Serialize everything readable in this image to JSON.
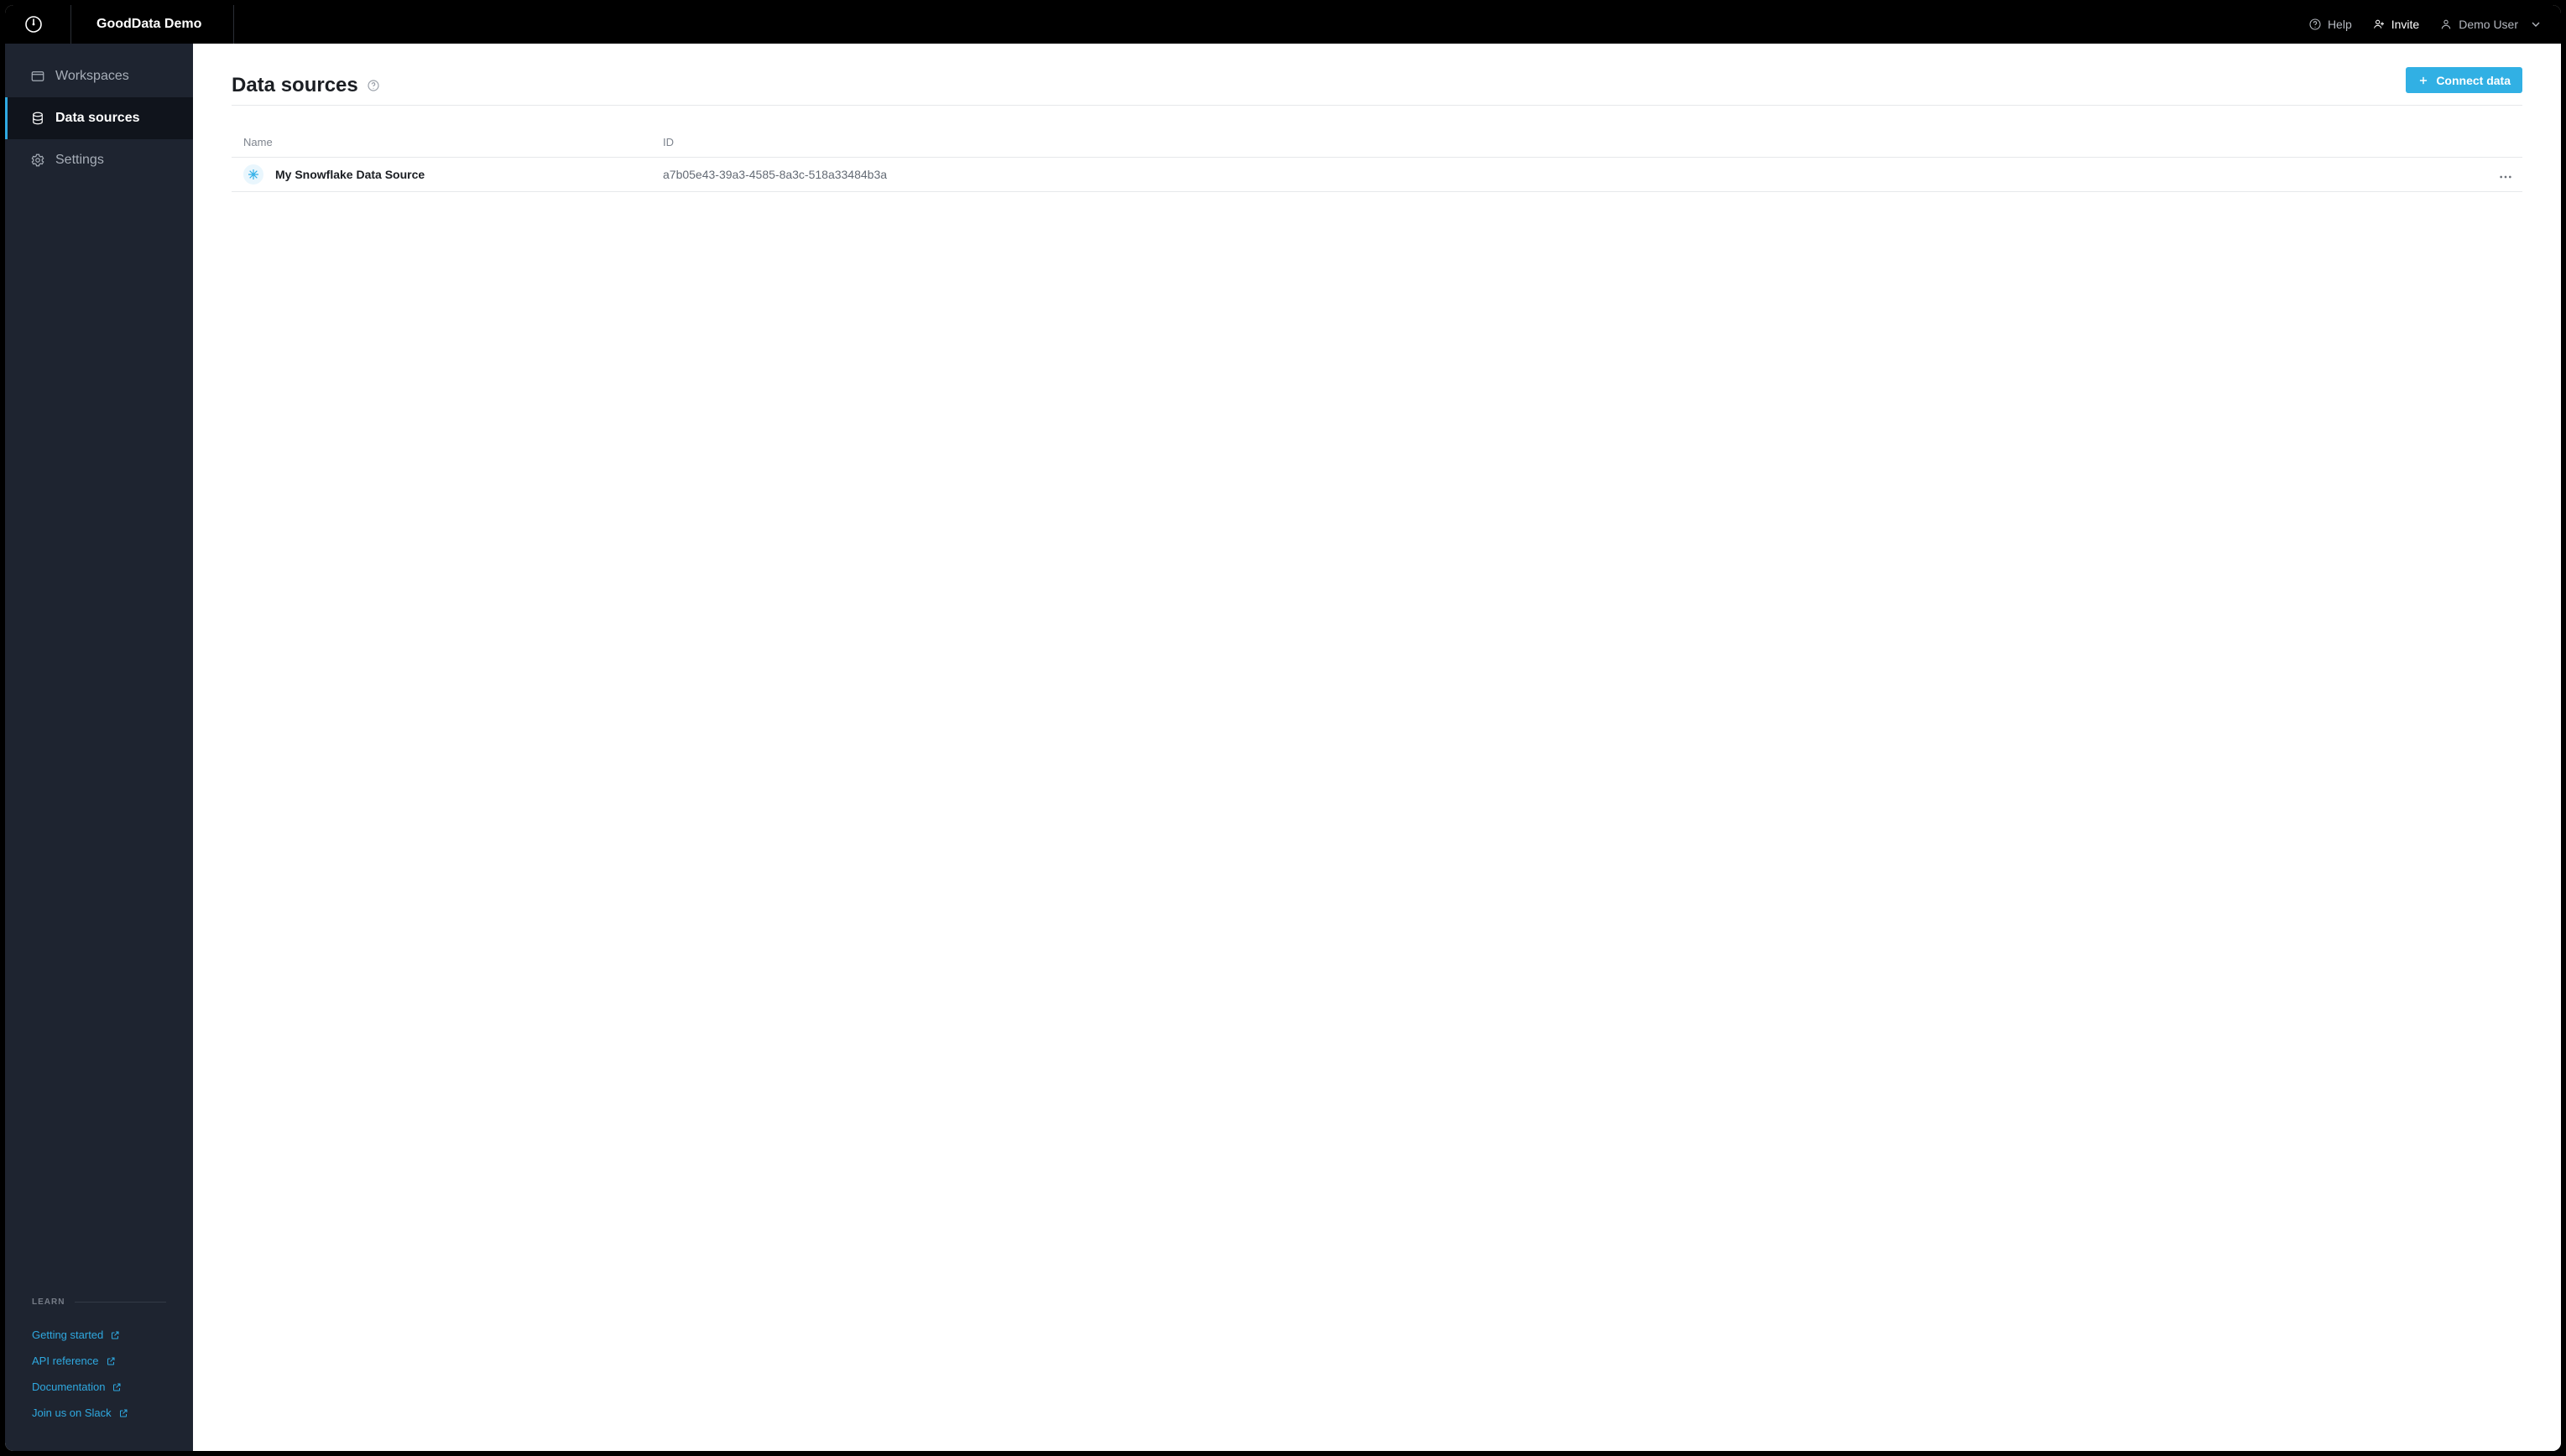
{
  "header": {
    "product_name": "GoodData Demo",
    "help_label": "Help",
    "invite_label": "Invite",
    "user_label": "Demo User"
  },
  "sidebar": {
    "items": [
      {
        "label": "Workspaces",
        "active": false
      },
      {
        "label": "Data sources",
        "active": true
      },
      {
        "label": "Settings",
        "active": false
      }
    ],
    "learn_heading": "LEARN",
    "learn_links": [
      {
        "label": "Getting started"
      },
      {
        "label": "API reference"
      },
      {
        "label": "Documentation"
      },
      {
        "label": "Join us on Slack"
      }
    ]
  },
  "page": {
    "title": "Data sources",
    "connect_label": "Connect data",
    "columns": {
      "name": "Name",
      "id": "ID"
    },
    "rows": [
      {
        "name": "My Snowflake Data Source",
        "id": "a7b05e43-39a3-4585-8a3c-518a33484b3a",
        "provider": "snowflake"
      }
    ]
  }
}
